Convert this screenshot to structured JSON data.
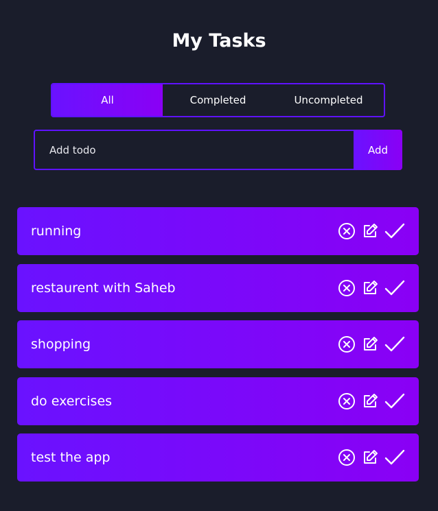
{
  "header": {
    "title": "My Tasks"
  },
  "filters": {
    "tabs": [
      {
        "label": "All",
        "active": true
      },
      {
        "label": "Completed",
        "active": false
      },
      {
        "label": "Uncompleted",
        "active": false
      }
    ]
  },
  "add_form": {
    "placeholder": "Add todo",
    "value": "",
    "button_label": "Add"
  },
  "todos": [
    {
      "text": "running"
    },
    {
      "text": "restaurent with Saheb"
    },
    {
      "text": "shopping"
    },
    {
      "text": "do exercises"
    },
    {
      "text": "test the app"
    }
  ],
  "icons": {
    "delete": "close-circle-icon",
    "edit": "edit-icon",
    "complete": "checkmark-icon"
  },
  "colors": {
    "background": "#1a1d2b",
    "accent_start": "#6a12ff",
    "accent_end": "#8a00f5",
    "border": "#5f12ff",
    "text": "#ffffff"
  }
}
